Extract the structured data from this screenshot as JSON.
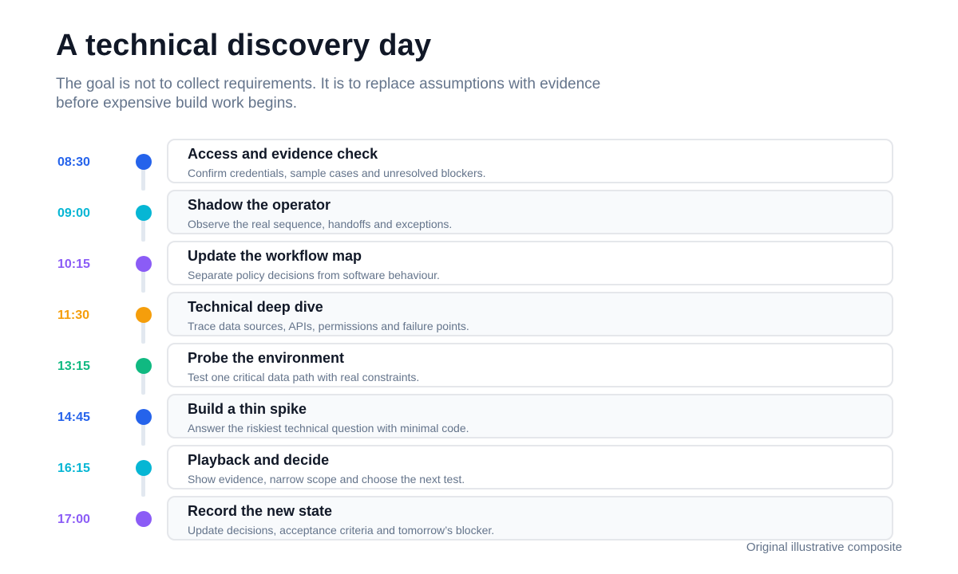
{
  "header": {
    "title": "A technical discovery day",
    "subtitle": "The goal is not to collect requirements. It is to replace assumptions with evidence before expensive build work begins."
  },
  "steps": [
    {
      "time": "08:30",
      "title": "Access and evidence check",
      "description": "Confirm credentials, sample cases and unresolved blockers.",
      "color": "#2563eb"
    },
    {
      "time": "09:00",
      "title": "Shadow the operator",
      "description": "Observe the real sequence, handoffs and exceptions.",
      "color": "#06b6d4"
    },
    {
      "time": "10:15",
      "title": "Update the workflow map",
      "description": "Separate policy decisions from software behaviour.",
      "color": "#8b5cf6"
    },
    {
      "time": "11:30",
      "title": "Technical deep dive",
      "description": "Trace data sources, APIs, permissions and failure points.",
      "color": "#f59e0b"
    },
    {
      "time": "13:15",
      "title": "Probe the environment",
      "description": "Test one critical data path with real constraints.",
      "color": "#10b981"
    },
    {
      "time": "14:45",
      "title": "Build a thin spike",
      "description": "Answer the riskiest technical question with minimal code.",
      "color": "#2563eb"
    },
    {
      "time": "16:15",
      "title": "Playback and decide",
      "description": "Show evidence, narrow scope and choose the next test.",
      "color": "#06b6d4"
    },
    {
      "time": "17:00",
      "title": "Record the new state",
      "description": "Update decisions, acceptance criteria and tomorrow’s blocker.",
      "color": "#8b5cf6"
    }
  ],
  "footer": {
    "note": "Original illustrative composite"
  }
}
